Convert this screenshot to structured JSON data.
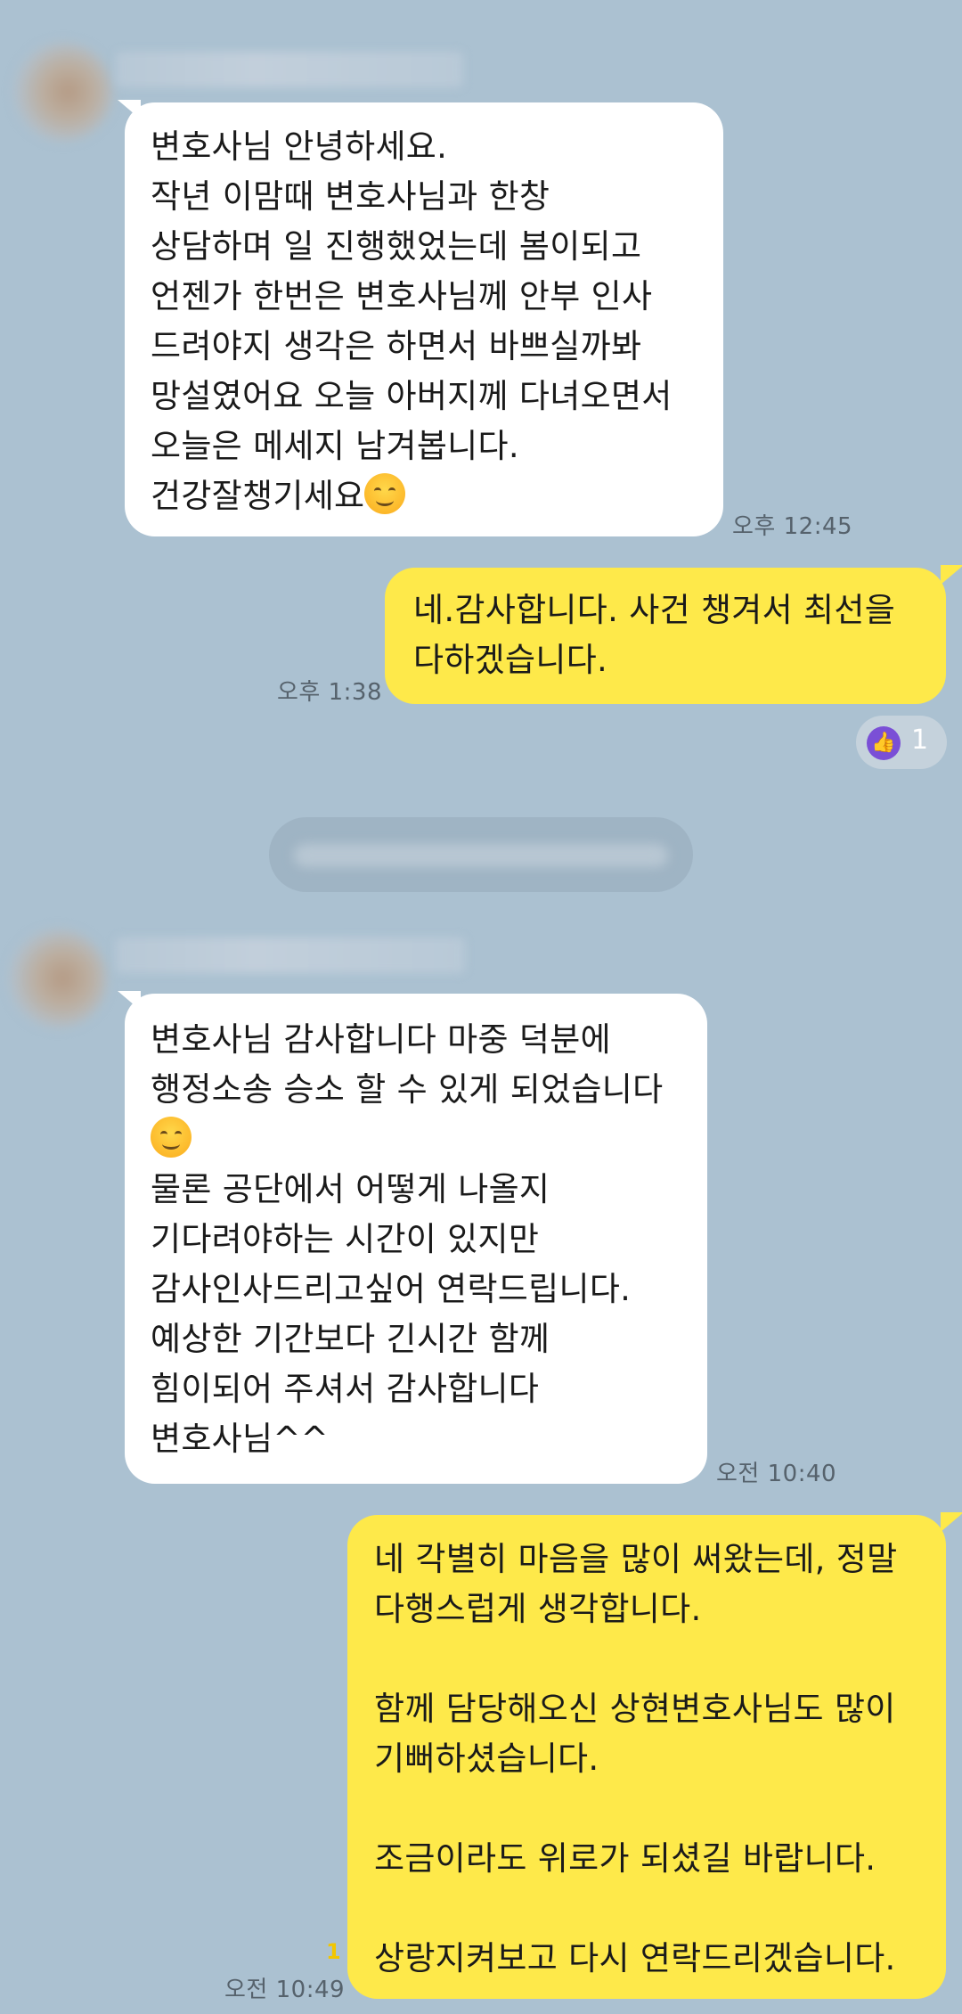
{
  "colors": {
    "background": "#abc1d1",
    "incoming_bubble": "#ffffff",
    "outgoing_bubble": "#fee94a",
    "unread_count": "#f2c600",
    "reaction": "#7a4fd6"
  },
  "messages": [
    {
      "direction": "incoming",
      "text": "변호사님 안녕하세요.\n작년 이맘때 변호사님과 한창\n상담하며 일 진행했었는데 봄이되고\n언젠가 한번은 변호사님께 안부 인사\n드려야지 생각은 하면서 바쁘실까봐\n망설였어요 오늘 아버지께 다녀오면서\n오늘은 메세지 남겨봅니다.\n건강잘챙기세요",
      "emoji": "smiling-face-emoji",
      "time": "오후 12:45"
    },
    {
      "direction": "outgoing",
      "text": "네.감사합니다. 사건 챙겨서 최선을\n다하겠습니다.",
      "time": "오후 1:38",
      "reaction": {
        "icon": "thumbs-up-icon",
        "count": "1"
      }
    },
    {
      "direction": "incoming",
      "text_before_emoji": "변호사님 감사합니다 마중 덕분에\n행정소송 승소 할 수 있게 되었습니다\n",
      "emoji": "smiling-face-emoji",
      "text_after_emoji": "\n물론 공단에서 어떻게 나올지\n기다려야하는 시간이 있지만\n감사인사드리고싶어 연락드립니다.\n예상한 기간보다 긴시간 함께\n힘이되어 주셔서 감사합니다\n변호사님^^",
      "time": "오전 10:40"
    },
    {
      "direction": "outgoing",
      "text": "네 각별히 마음을 많이 써왔는데, 정말\n다행스럽게 생각합니다.\n\n함께 담당해오신 상현변호사님도 많이\n기뻐하셨습니다.\n\n조금이라도 위로가 되셨길 바랍니다.\n\n상랑지켜보고 다시 연락드리겠습니다.",
      "time": "오전 10:49",
      "unread": "1"
    }
  ]
}
